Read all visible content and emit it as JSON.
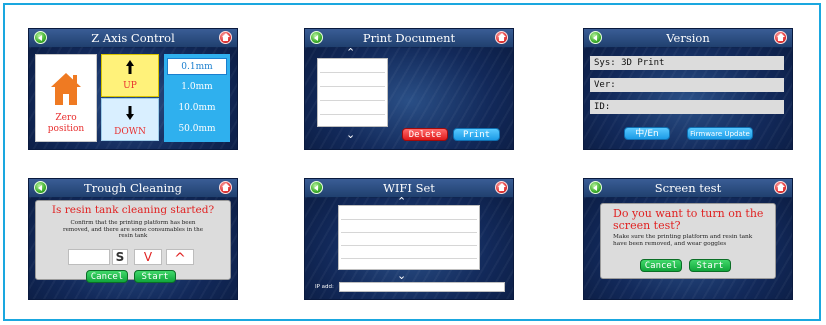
{
  "screens": {
    "z_axis": {
      "title": "Z Axis Control",
      "zero_label": "Zero\nposition",
      "up_label": "UP",
      "down_label": "DOWN",
      "steps": [
        "0.1mm",
        "1.0mm",
        "10.0mm",
        "50.0mm"
      ],
      "selected_step": "0.1mm"
    },
    "print_document": {
      "title": "Print Document",
      "delete_label": "Delete",
      "print_label": "Print"
    },
    "version": {
      "title": "Version",
      "rows": [
        "Sys: 3D Print",
        "Ver:",
        "ID:"
      ],
      "language_label": "中/En",
      "firmware_label": "Firmware Update"
    },
    "trough_cleaning": {
      "title": "Trough Cleaning",
      "question": "Is resin tank cleaning started?",
      "detail": "Confirm that the printing platform has been removed, and there are some consumables in the resin tank",
      "s_label": "S",
      "down_glyph": "V",
      "up_glyph": "^",
      "cancel_label": "Cancel",
      "start_label": "Start"
    },
    "wifi_set": {
      "title": "WIFI Set",
      "ip_label": "IP add:"
    },
    "screen_test": {
      "title": "Screen test",
      "question": "Do you want to turn on the screen test?",
      "detail": "Make sure the printing platform and resin tank have been removed, and wear goggles",
      "cancel_label": "Cancel",
      "start_label": "Start"
    }
  },
  "colors": {
    "border": "#1aa7df",
    "screen_bg": "#12295a",
    "accent_blue": "#2fb0ee",
    "accent_red": "#e02222",
    "accent_green": "#11a63c",
    "up_yellow": "#fff27a"
  },
  "icons": {
    "back": "back-arrow-icon",
    "home": "home-icon",
    "zero": "house-icon",
    "up": "up-arrow-icon",
    "down": "down-arrow-icon",
    "scroll_up": "chevron-up-icon",
    "scroll_down": "chevron-down-icon"
  }
}
